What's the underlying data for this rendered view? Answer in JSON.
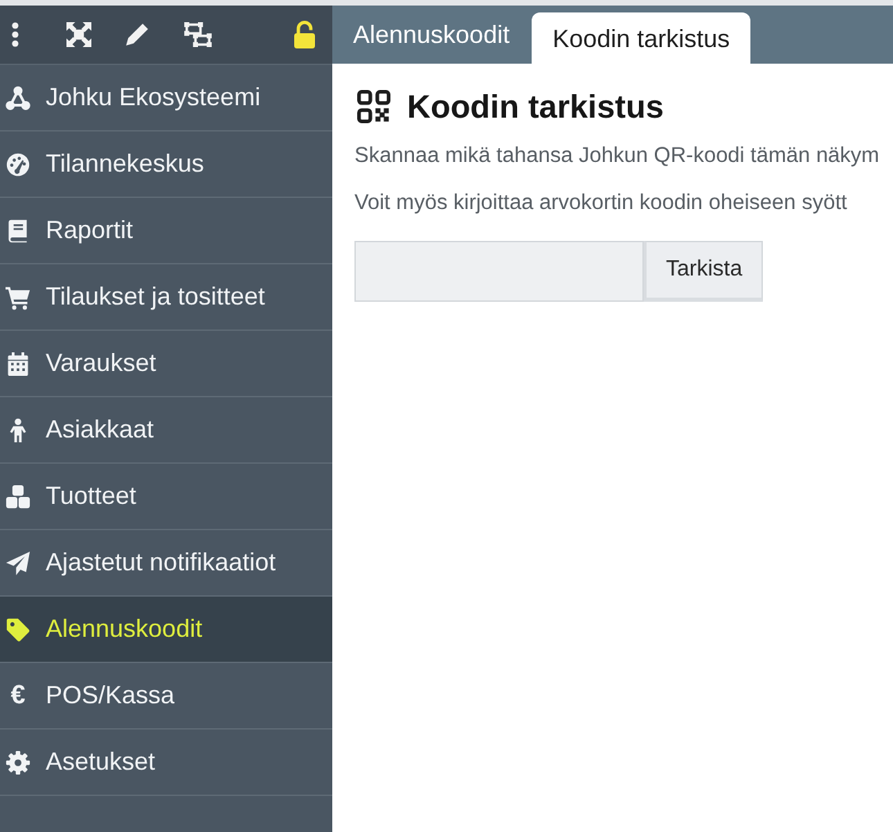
{
  "sidebar": {
    "locked": false,
    "items": [
      {
        "label": "Johku Ekosysteemi",
        "selected": false
      },
      {
        "label": "Tilannekeskus",
        "selected": false
      },
      {
        "label": "Raportit",
        "selected": false
      },
      {
        "label": "Tilaukset ja tositteet",
        "selected": false
      },
      {
        "label": "Varaukset",
        "selected": false
      },
      {
        "label": "Asiakkaat",
        "selected": false
      },
      {
        "label": "Tuotteet",
        "selected": false
      },
      {
        "label": "Ajastetut notifikaatiot",
        "selected": false
      },
      {
        "label": "Alennuskoodit",
        "selected": true
      },
      {
        "label": "POS/Kassa",
        "selected": false,
        "icon_char": "€"
      },
      {
        "label": "Asetukset",
        "selected": false
      }
    ]
  },
  "tabs": [
    {
      "label": "Alennuskoodit",
      "selected": false
    },
    {
      "label": "Koodin tarkistus",
      "selected": true
    }
  ],
  "page": {
    "title": "Koodin tarkistus",
    "paragraphs": [
      "Skannaa mikä tahansa Johkun QR-koodi tämän näkym",
      "Voit myös kirjoittaa arvokortin koodin oheiseen syött"
    ],
    "button": "Tarkista"
  }
}
